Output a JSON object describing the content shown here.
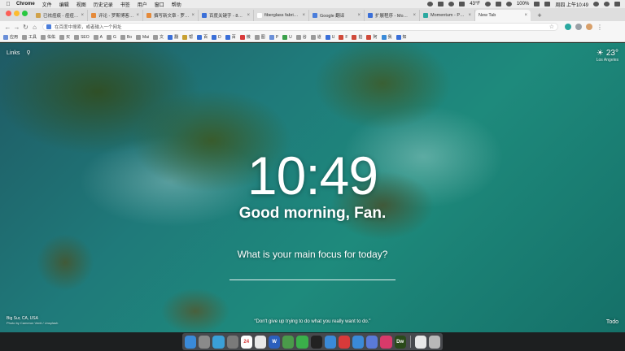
{
  "menubar": {
    "app_name": "Chrome",
    "items": [
      "文件",
      "编辑",
      "视图",
      "历史记录",
      "书签",
      "用户",
      "窗口",
      "帮助"
    ],
    "status": {
      "battery_text": "100%",
      "temp": "43°F",
      "clock": "周四 上午10:49"
    }
  },
  "tabs": [
    {
      "title": "已祛痘痕 - 痘痘去疤 - 小",
      "color": "#d0a24a"
    },
    {
      "title": "评论 - 罗斯博客 — Wor",
      "color": "#e58a3a"
    },
    {
      "title": "撰写新文章 - 罗斯博客",
      "color": "#e58a3a"
    },
    {
      "title": "百度关键字 - 824-918",
      "color": "#3a6fd8"
    },
    {
      "title": "fiberglass fabrics manu",
      "color": "#ffffff"
    },
    {
      "title": "Google 翻译",
      "color": "#4a7ddb"
    },
    {
      "title": "扩展程序 - Momentum",
      "color": "#3a6fd8"
    },
    {
      "title": "Momentum - Personal D",
      "color": "#2aa8a0"
    },
    {
      "title": "New Tab",
      "color": "",
      "active": true
    }
  ],
  "omnibox": {
    "placeholder": "在百度中搜索，或者输入一个网址"
  },
  "bookmarks": [
    {
      "label": "应用",
      "color": "#6a8fd8"
    },
    {
      "label": "工具",
      "color": "#9a9a9a"
    },
    {
      "label": "佑佑",
      "color": "#9a9a9a"
    },
    {
      "label": "买",
      "color": "#9a9a9a"
    },
    {
      "label": "SEO",
      "color": "#9a9a9a"
    },
    {
      "label": "A",
      "color": "#9a9a9a"
    },
    {
      "label": "G",
      "color": "#9a9a9a"
    },
    {
      "label": "Bo",
      "color": "#9a9a9a"
    },
    {
      "label": "Mai",
      "color": "#9a9a9a"
    },
    {
      "label": "文",
      "color": "#9a9a9a"
    },
    {
      "label": "翻",
      "color": "#3a6fd8"
    },
    {
      "label": "帮",
      "color": "#c8a030"
    },
    {
      "label": "百",
      "color": "#3a6fd8"
    },
    {
      "label": "D",
      "color": "#3a6fd8"
    },
    {
      "label": "百",
      "color": "#3a6fd8"
    },
    {
      "label": "微",
      "color": "#d83a3a"
    },
    {
      "label": "图",
      "color": "#9a9a9a"
    },
    {
      "label": "P",
      "color": "#6a8fd8"
    },
    {
      "label": "U",
      "color": "#3aa04a"
    },
    {
      "label": "谷",
      "color": "#9a9a9a"
    },
    {
      "label": "道",
      "color": "#9a9a9a"
    },
    {
      "label": "U",
      "color": "#3a6fd8"
    },
    {
      "label": "F",
      "color": "#d04a3a"
    },
    {
      "label": "拍",
      "color": "#d04a3a"
    },
    {
      "label": "阿",
      "color": "#d04a3a"
    },
    {
      "label": "我",
      "color": "#3a8ad8"
    },
    {
      "label": "知",
      "color": "#3a6fd8"
    }
  ],
  "momentum": {
    "links_label": "Links",
    "temperature": "23°",
    "location": "Los Angeles",
    "time": "10:49",
    "greeting": "Good morning, Fan.",
    "focus_question": "What is your main focus for today?",
    "photo_location": "Big Sur, CA, USA",
    "photo_credit": "Photo by Cameron Venti / Unsplash",
    "quote": "“Don't give up trying to do what you really want to do.”",
    "todo_label": "Todo"
  },
  "dock": [
    {
      "name": "finder",
      "color": "#3a8ad8",
      "label": ""
    },
    {
      "name": "launchpad",
      "color": "#8a8a8a",
      "label": ""
    },
    {
      "name": "safari",
      "color": "#3aa0d8",
      "label": ""
    },
    {
      "name": "system-preferences",
      "color": "#7a7a7a",
      "label": ""
    },
    {
      "name": "calendar",
      "color": "#ffffff",
      "label": "24"
    },
    {
      "name": "textedit",
      "color": "#e8e8e8",
      "label": ""
    },
    {
      "name": "word",
      "color": "#2b5fbd",
      "label": "W"
    },
    {
      "name": "chrome",
      "color": "#4a9a4a",
      "label": ""
    },
    {
      "name": "wechat",
      "color": "#3ab04a",
      "label": ""
    },
    {
      "name": "qq",
      "color": "#222222",
      "label": ""
    },
    {
      "name": "baidu-netdisk",
      "color": "#3a8ad8",
      "label": ""
    },
    {
      "name": "weibo",
      "color": "#d83a3a",
      "label": ""
    },
    {
      "name": "tool",
      "color": "#3a8ad8",
      "label": ""
    },
    {
      "name": "migrate",
      "color": "#5a7ad8",
      "label": ""
    },
    {
      "name": "app-red",
      "color": "#d83a6a",
      "label": ""
    },
    {
      "name": "dreamweaver",
      "color": "#2a4a1a",
      "label": "Dw"
    },
    {
      "name": "documents",
      "color": "#e8e8e8",
      "label": ""
    },
    {
      "name": "trash",
      "color": "#b8b8b8",
      "label": ""
    }
  ]
}
